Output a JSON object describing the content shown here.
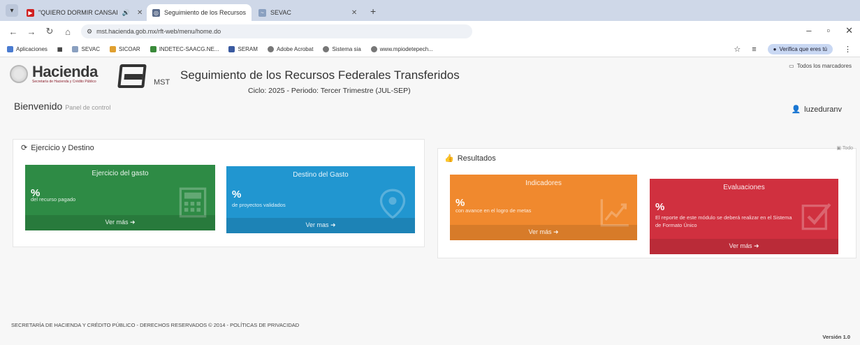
{
  "browser": {
    "tabs": [
      {
        "title": "\"QUIERO DORMIR CANSAI",
        "active": false,
        "favicon": "youtube-icon",
        "color": "#d02020"
      },
      {
        "title": "Seguimiento de los Recursos",
        "active": true,
        "favicon": "globe-icon",
        "color": "#5a6b8a"
      },
      {
        "title": "SEVAC",
        "active": false,
        "favicon": "sevac-icon",
        "color": "#8aa0c0"
      }
    ],
    "url": "mst.hacienda.gob.mx/rft-web/menu/home.do",
    "bookmarks": [
      "Aplicaciones",
      "SEVAC",
      "SICOAR",
      "INDETEC-SAACG.NE...",
      "SERAM",
      "Adobe Acrobat",
      "Sistema sia",
      "www.mpiodetepech..."
    ],
    "verify_label": "Verifica que eres tú",
    "all_bookmarks": "Todos los marcadores"
  },
  "header": {
    "logo_text": "Hacienda",
    "logo_sub": "Secretaría de Hacienda y Crédito Público",
    "system_short": "MST",
    "system_title": "Seguimiento de los Recursos Federales Transferidos",
    "cycle": "Ciclo: 2025 - Periodo: Tercer Trimestre (JUL-SEP)",
    "username": "luzeduranv"
  },
  "welcome": {
    "title": "Bienvenido",
    "subtitle": "Panel de control"
  },
  "ejercicio": {
    "heading": "Ejercicio y Destino",
    "tiles": [
      {
        "title": "Ejercicio del gasto",
        "pct": "%",
        "desc": "del recurso pagado",
        "more": "Ver más",
        "color": "#2e8b45",
        "icon": "calculator-icon"
      },
      {
        "title": "Destino del Gasto",
        "pct": "%",
        "desc": "de proyectos validados",
        "more": "Ver mas",
        "color": "#2196d0",
        "icon": "map-marker-icon"
      }
    ]
  },
  "resultados": {
    "heading": "Resultados",
    "todo": "Todo",
    "tiles": [
      {
        "title": "Indicadores",
        "pct": "%",
        "desc": "con avance en el logro de metas",
        "more": "Ver más",
        "color": "#f0892e",
        "icon": "line-chart-icon"
      },
      {
        "title": "Evaluaciones",
        "pct": "%",
        "desc": "El reporte de este módulo se deberá realizar en el Sistema de Formato Único",
        "more": "Ver más",
        "color": "#d0303f",
        "icon": "checkbox-icon"
      }
    ]
  },
  "footer": {
    "text": "SECRETARÍA DE HACIENDA Y CRÉDITO PÚBLICO - DERECHOS RESERVADOS © 2014 - POLÍTICAS DE PRIVACIDAD",
    "version": "Versión 1.0"
  }
}
